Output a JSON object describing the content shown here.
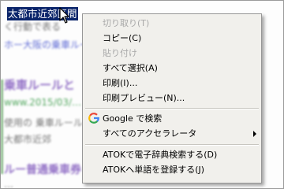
{
  "page": {
    "selected_text": "太都市近郊区間",
    "background_lines": [
      "く行動で表る",
      "ホー大阪の乗車ルールと…",
      "乗車ルールと",
      "www.2015/03/…",
      "使用の 乗車ルールと",
      "大都市近郊",
      "ルー普通乗車券",
      "…"
    ]
  },
  "menu": {
    "items": [
      {
        "label": "切り取り(T)",
        "enabled": false
      },
      {
        "label": "コピー(C)",
        "enabled": true
      },
      {
        "label": "貼り付け",
        "enabled": false
      },
      {
        "label": "すべて選択(A)",
        "enabled": true
      },
      {
        "label": "印刷(I)...",
        "enabled": true
      },
      {
        "label": "印刷プレビュー(N)...",
        "enabled": true
      },
      {
        "label": "Google で検索",
        "enabled": true,
        "icon": "google-icon"
      },
      {
        "label": "すべてのアクセラレータ",
        "enabled": true,
        "submenu": true
      },
      {
        "label": "ATOKで電子辞典検索する(D)",
        "enabled": true
      },
      {
        "label": "ATOKへ単語を登録する(J)",
        "enabled": true
      }
    ]
  },
  "colors": {
    "menu_bg": "#f1f0ec",
    "selection_bg": "#0a246a",
    "disabled_text": "#a9a9a9",
    "google_blue": "#4285f4",
    "google_red": "#ea4335",
    "google_yellow": "#fbbc05",
    "google_green": "#34a853"
  }
}
